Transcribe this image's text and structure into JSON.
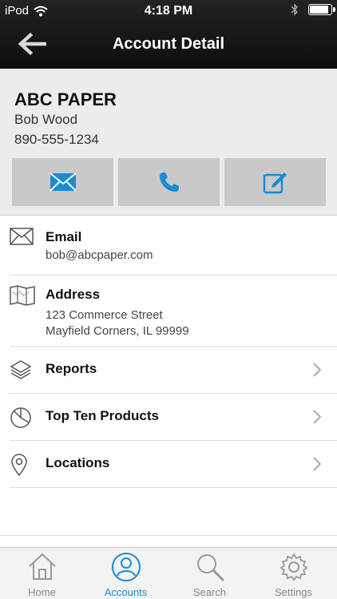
{
  "status_bar": {
    "carrier": "iPod",
    "time": "4:18 PM",
    "battery_level": 0.9
  },
  "nav": {
    "title": "Account Detail",
    "back_icon": "arrow-left-icon"
  },
  "account": {
    "company": "ABC PAPER",
    "contact_name": "Bob Wood",
    "phone": "890-555-1234"
  },
  "actions": [
    {
      "icon": "mail-icon"
    },
    {
      "icon": "phone-icon"
    },
    {
      "icon": "edit-icon"
    }
  ],
  "details": {
    "email": {
      "label": "Email",
      "value": "bob@abcpaper.com"
    },
    "address": {
      "label": "Address",
      "line1": "123 Commerce Street",
      "line2": "Mayfield Corners, IL 99999"
    }
  },
  "links": [
    {
      "label": "Reports",
      "icon": "layers-icon"
    },
    {
      "label": "Top Ten Products",
      "icon": "pie-chart-icon"
    },
    {
      "label": "Locations",
      "icon": "map-pin-icon"
    }
  ],
  "tabs": [
    {
      "label": "Home",
      "icon": "home-icon",
      "active": false
    },
    {
      "label": "Accounts",
      "icon": "user-icon",
      "active": true
    },
    {
      "label": "Search",
      "icon": "search-icon",
      "active": false
    },
    {
      "label": "Settings",
      "icon": "gear-icon",
      "active": false
    }
  ],
  "colors": {
    "accent": "#1a8bd6",
    "tab_inactive": "#888888",
    "action_bg": "#c9c9c9",
    "header_bg": "#ececec",
    "topbar_bg": "#111111"
  }
}
